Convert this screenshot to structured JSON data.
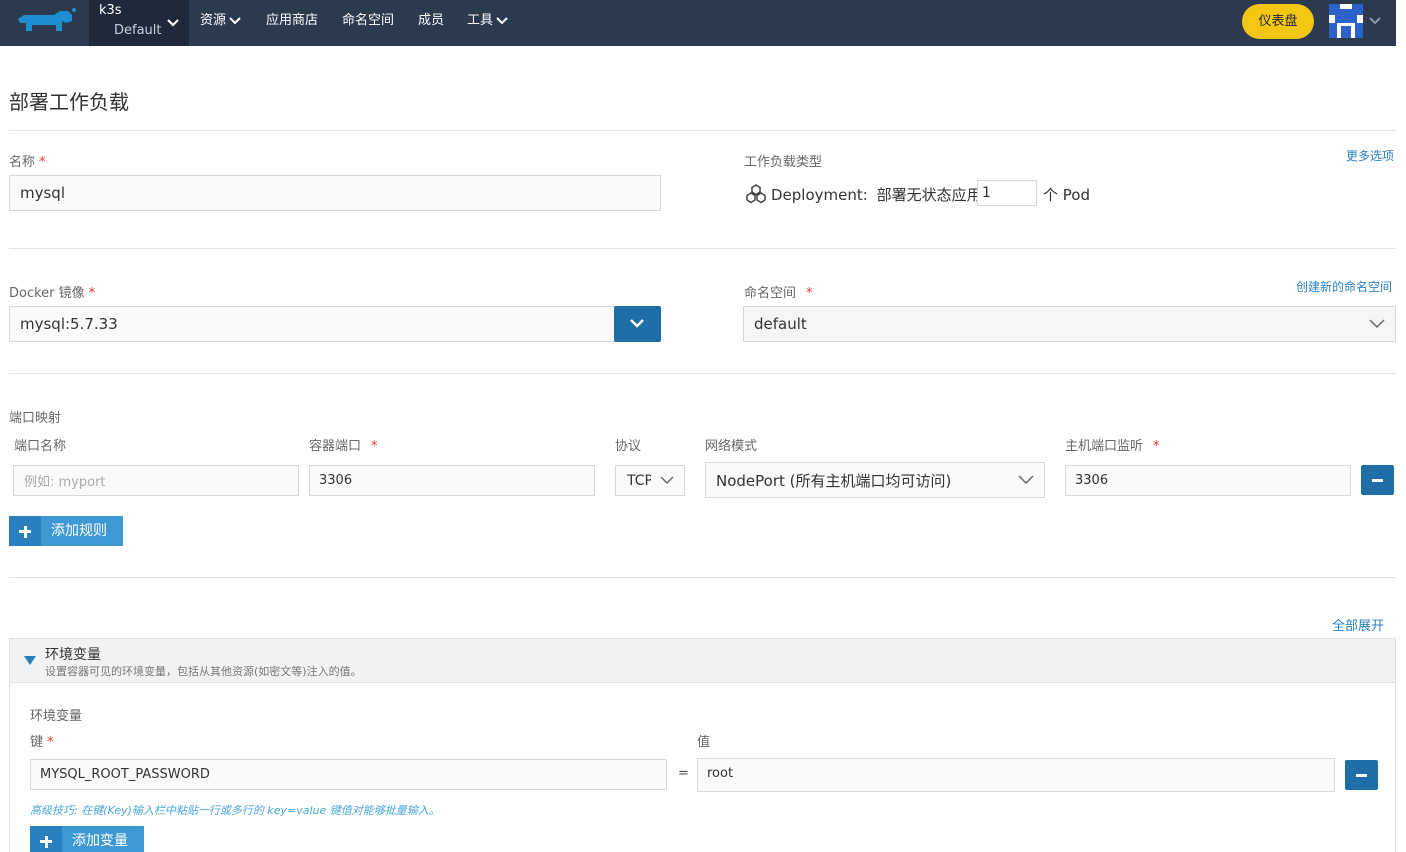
{
  "topnav": {
    "cluster_name": "k3s",
    "project_name": "Default",
    "menu": [
      {
        "label": "资源",
        "has_dropdown": true
      },
      {
        "label": "应用商店",
        "has_dropdown": false
      },
      {
        "label": "命名空间",
        "has_dropdown": false
      },
      {
        "label": "成员",
        "has_dropdown": false
      },
      {
        "label": "工具",
        "has_dropdown": true
      }
    ],
    "dashboard_button": "仪表盘",
    "accent_color": "#f3c613",
    "bar_color": "#2b3a4f"
  },
  "page": {
    "title": "部署工作负载"
  },
  "name_field": {
    "label": "名称",
    "required": "*",
    "value": "mysql"
  },
  "workload_type": {
    "label": "工作负载类型",
    "more_options": "更多选项",
    "icon": "cubes-icon",
    "type_text": "Deployment:",
    "type_desc": "部署无状态应用",
    "replicas": "1",
    "unit": "个 Pod"
  },
  "docker_image": {
    "label": "Docker 镜像",
    "required": "*",
    "value": "mysql:5.7.33"
  },
  "namespace": {
    "label": "命名空间",
    "required": "*",
    "create_link": "创建新的命名空间",
    "value": "default"
  },
  "port_mapping": {
    "section_label": "端口映射",
    "columns": {
      "port_name": "端口名称",
      "container_port": "容器端口",
      "protocol": "协议",
      "network_mode": "网络模式",
      "host_port": "主机端口监听"
    },
    "required": "*",
    "row": {
      "port_name_placeholder": "例如: myport",
      "container_port": "3306",
      "protocol": "TCP",
      "network_mode": "NodePort (所有主机端口均可访问)",
      "host_port": "3306"
    },
    "add_rule": "添加规则"
  },
  "env": {
    "expand_all": "全部展开",
    "section_title": "环境变量",
    "section_desc": "设置容器可见的环境变量，包括从其他资源(如密文等)注入的值。",
    "sub_label": "环境变量",
    "key_label": "键",
    "required": "*",
    "value_label": "值",
    "equals": "=",
    "row": {
      "key": "MYSQL_ROOT_PASSWORD",
      "value": "root"
    },
    "tip": "高级技巧: 在键(Key)输入栏中粘贴一行或多行的 key=value 键值对能够批量输入。",
    "add_var": "添加变量"
  }
}
